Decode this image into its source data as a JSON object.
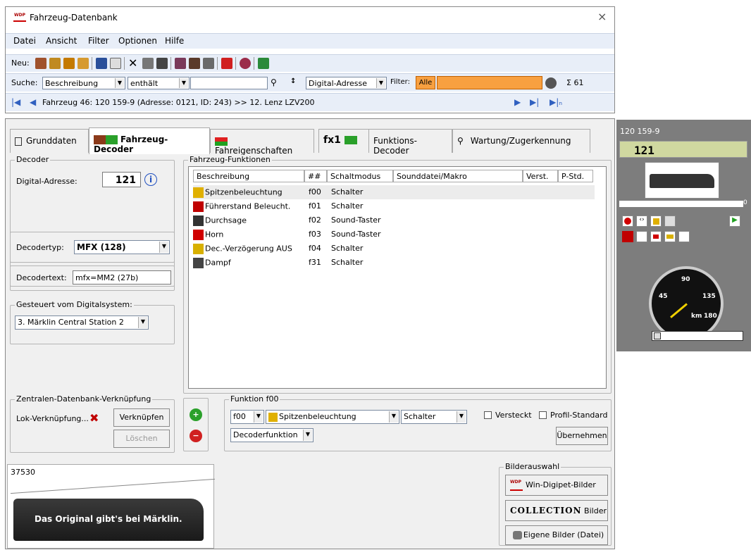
{
  "window": {
    "title": "Fahrzeug-Datenbank",
    "close": "×"
  },
  "menu": [
    "Datei",
    "Ansicht",
    "Filter",
    "Optionen",
    "Hilfe"
  ],
  "toolbar": {
    "new_label": "Neu:"
  },
  "search": {
    "label": "Suche:",
    "field": "Beschreibung",
    "mode": "enthält",
    "value": "",
    "sort": "Digital-Adresse",
    "filter_label": "Filter:",
    "filter_all": "Alle",
    "sigma": "Σ 61"
  },
  "nav": {
    "record": "Fahrzeug 46: 120 159-9 (Adresse: 0121, ID: 243) >> 12. Lenz LZV200"
  },
  "tabs": [
    "Grunddaten",
    "Fahrzeug-Decoder",
    "Fahreigenschaften",
    "fx1",
    "Funktions-Decoder",
    "Wartung/Zugerkennung"
  ],
  "decoder": {
    "legend": "Decoder",
    "address_label": "Digital-Adresse:",
    "address": "121",
    "type_label": "Decodertyp:",
    "type": "MFX (128)",
    "text_label": "Decodertext:",
    "text": "mfx=MM2 (27b)"
  },
  "digital": {
    "legend": "Gesteuert vom Digitalsystem:",
    "system": "3. Märklin Central Station 2"
  },
  "zdb": {
    "legend": "Zentralen-Datenbank-Verknüpfung",
    "label": "Lok-Verknüpfung...",
    "link": "Verknüpfen",
    "delete": "Löschen"
  },
  "functions": {
    "legend": "Fahrzeug-Funktionen",
    "columns": [
      "Beschreibung",
      "##",
      "Schaltmodus",
      "Sounddatei/Makro",
      "Verst.",
      "P-Std."
    ],
    "rows": [
      {
        "name": "Spitzenbeleuchtung",
        "num": "f00",
        "mode": "Schalter",
        "color": "#e0b000"
      },
      {
        "name": "Führerstand Beleucht.",
        "num": "f01",
        "mode": "Schalter",
        "color": "#c00000"
      },
      {
        "name": "Durchsage",
        "num": "f02",
        "mode": "Sound-Taster",
        "color": "#333333"
      },
      {
        "name": "Horn",
        "num": "f03",
        "mode": "Sound-Taster",
        "color": "#d00000"
      },
      {
        "name": "Dec.-Verzögerung AUS",
        "num": "f04",
        "mode": "Schalter",
        "color": "#d8b000"
      },
      {
        "name": "Dampf",
        "num": "f31",
        "mode": "Schalter",
        "color": "#444444"
      }
    ]
  },
  "func_edit": {
    "legend": "Funktion f00",
    "num": "f00",
    "name": "Spitzenbeleuchtung",
    "mode": "Schalter",
    "kind": "Decoderfunktion",
    "hidden": "Versteckt",
    "profile": "Profil-Standard",
    "apply": "Übernehmen"
  },
  "image": {
    "number": "37530",
    "caption": "Das Original gibt's bei Märklin."
  },
  "pictures": {
    "legend": "Bilderauswahl",
    "wdp": "Win-Digipet-Bilder",
    "collection": "COLLECTION",
    "collection_suffix": "Bilder",
    "own": "Eigene Bilder (Datei)"
  },
  "cab": {
    "title": "120 159-9",
    "display": "121",
    "speed_ticks": [
      "45",
      "90",
      "135",
      "180"
    ],
    "unit": "km",
    "zero": "0"
  }
}
